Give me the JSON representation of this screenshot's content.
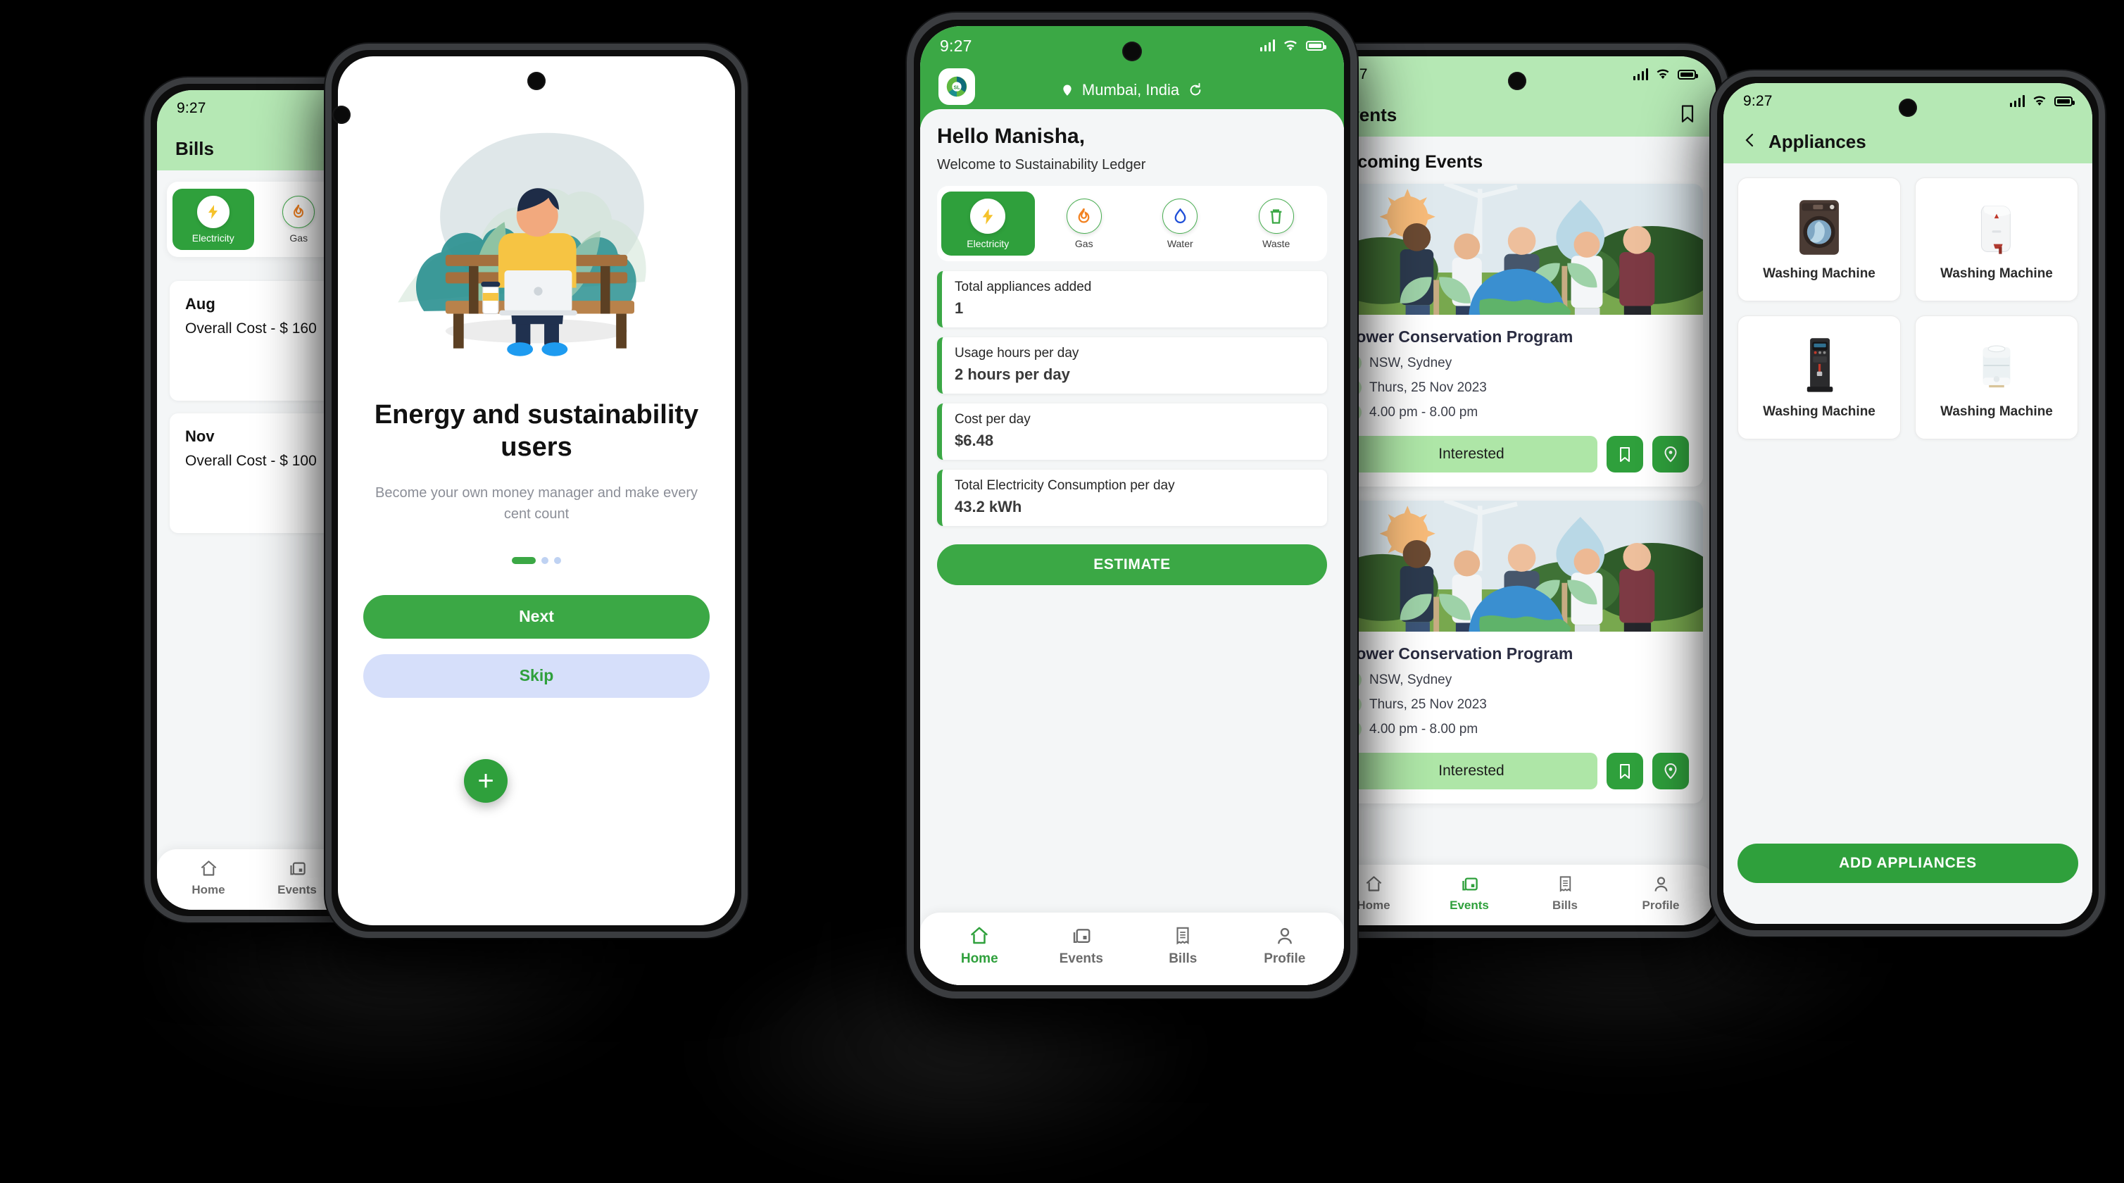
{
  "app": {
    "name": "Sustainability Ledger",
    "accent": "#3ba845",
    "accent_dark": "#2fa03c",
    "header_light_green": "#b5e8b4",
    "logo_text": "SL"
  },
  "status_bar": {
    "time": "9:27"
  },
  "utilities": [
    {
      "label": "Electricity",
      "icon": "bolt-icon",
      "color": "#f5c22b",
      "active": true
    },
    {
      "label": "Gas",
      "icon": "flame-icon",
      "color": "#f28120",
      "active": false
    },
    {
      "label": "Water",
      "icon": "water-drop-icon",
      "color": "#1f4fd8",
      "active": false
    },
    {
      "label": "Waste",
      "icon": "trash-icon",
      "color": "#3ba845",
      "active": false
    }
  ],
  "bottom_nav": [
    {
      "label": "Home",
      "icon": "home-icon"
    },
    {
      "label": "Events",
      "icon": "calendar-icon"
    },
    {
      "label": "Bills",
      "icon": "receipt-icon"
    },
    {
      "label": "Profile",
      "icon": "person-icon"
    }
  ],
  "screens": {
    "bills": {
      "title": "Bills",
      "chart_icon": "chart-icon",
      "active_nav": "Bills",
      "fab_label": "+",
      "items": [
        {
          "month": "Aug",
          "cost": "Overall Cost - $ 160"
        },
        {
          "month": "Nov",
          "cost": "Overall Cost - $ 100"
        }
      ]
    },
    "onboarding": {
      "illustration": "person-on-bench-with-laptop-illustration",
      "title": "Energy and sustainability users",
      "subtitle": "Become your own money manager and make every cent count",
      "dots": {
        "total": 3,
        "active_index": 0
      },
      "next_label": "Next",
      "skip_label": "Skip"
    },
    "home": {
      "location": "Mumbai, India",
      "refresh_icon": "refresh-icon",
      "location_icon": "location-pin-icon",
      "greeting": "Hello Manisha,",
      "welcome": "Welcome to Sustainability Ledger",
      "stats": [
        {
          "key": "Total appliances added",
          "value": "1"
        },
        {
          "key": "Usage hours per day",
          "value": "2 hours per day"
        },
        {
          "key": "Cost per day",
          "value": "$6.48"
        },
        {
          "key": "Total Electricity Consumption per day",
          "value": "43.2 kWh"
        }
      ],
      "estimate_label": "ESTIMATE",
      "active_nav": "Home"
    },
    "events": {
      "title": "Events",
      "bookmark_icon": "bookmark-icon",
      "section_heading": "Upcoming Events",
      "active_nav": "Events",
      "cards": [
        {
          "title": "Power Conservation Program",
          "location": "NSW, Sydney",
          "date": "Thurs, 25 Nov 2023",
          "time": "4.00 pm - 8.00 pm",
          "interested_label": "Interested",
          "save_icon": "bookmark-icon",
          "map_icon": "location-pin-icon"
        },
        {
          "title": "Power Conservation Program",
          "location": "NSW, Sydney",
          "date": "Thurs, 25 Nov 2023",
          "time": "4.00 pm - 8.00 pm",
          "interested_label": "Interested",
          "save_icon": "bookmark-icon",
          "map_icon": "location-pin-icon"
        }
      ]
    },
    "appliances": {
      "title": "Appliances",
      "back_icon": "back-arrow-icon",
      "add_label": "ADD APPLIANCES",
      "items": [
        {
          "name": "Washing Machine",
          "image": "front-load-washer-image"
        },
        {
          "name": "Washing Machine",
          "image": "water-heater-image"
        },
        {
          "name": "Washing Machine",
          "image": "water-dispenser-image"
        },
        {
          "name": "Washing Machine",
          "image": "humidifier-image"
        }
      ]
    }
  }
}
